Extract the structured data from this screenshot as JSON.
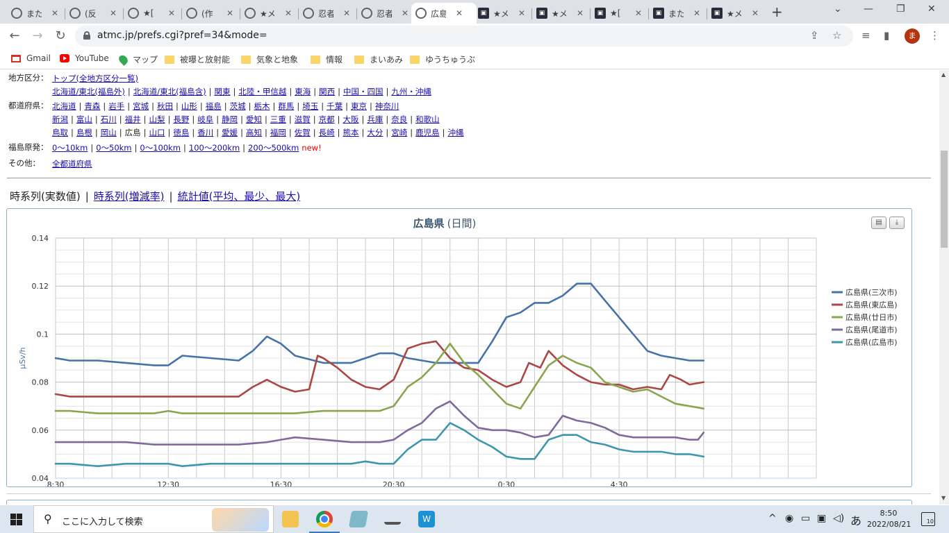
{
  "browser": {
    "tabs": [
      {
        "title": "また",
        "icon": "globe-icon",
        "active": false
      },
      {
        "title": "(反",
        "icon": "globe-icon",
        "active": false
      },
      {
        "title": "★[",
        "icon": "globe-icon",
        "active": false
      },
      {
        "title": "(作",
        "icon": "globe-icon",
        "active": false
      },
      {
        "title": "★メ",
        "icon": "globe-icon",
        "active": false
      },
      {
        "title": "忍者",
        "icon": "globe-icon",
        "active": false
      },
      {
        "title": "忍者",
        "icon": "globe-icon",
        "active": false
      },
      {
        "title": "広島",
        "icon": "globe-icon",
        "active": true
      },
      {
        "title": "★メ",
        "icon": "site-icon",
        "active": false
      },
      {
        "title": "★メ",
        "icon": "site-icon",
        "active": false
      },
      {
        "title": "★[",
        "icon": "site-icon",
        "active": false
      },
      {
        "title": "また",
        "icon": "site-icon",
        "active": false
      },
      {
        "title": "★メ",
        "icon": "site-icon",
        "active": false
      }
    ],
    "url": "atmc.jp/prefs.cgi?pref=34&mode=",
    "avatar_letter": "ま",
    "bookmarks": [
      {
        "label": "Gmail",
        "icon": "gmail-icon"
      },
      {
        "label": "YouTube",
        "icon": "youtube-icon"
      },
      {
        "label": "マップ",
        "icon": "maps-icon"
      },
      {
        "label": "被曝と放射能",
        "icon": "folder-icon"
      },
      {
        "label": "気象と地象",
        "icon": "folder-icon"
      },
      {
        "label": "情報",
        "icon": "folder-icon"
      },
      {
        "label": "まいあみ",
        "icon": "folder-icon"
      },
      {
        "label": "ゆうちゅうぶ",
        "icon": "folder-icon"
      }
    ]
  },
  "nav": {
    "region_label": "地方区分：",
    "region_lines": [
      [
        {
          "text": "トップ(全地方区分一覧)",
          "link": true
        }
      ],
      [
        {
          "text": "北海道/東北(福島外)",
          "link": true
        },
        {
          "text": "北海道/東北(福島含)",
          "link": true
        },
        {
          "text": "関東",
          "link": true
        },
        {
          "text": "北陸・甲信越",
          "link": true
        },
        {
          "text": "東海",
          "link": true
        },
        {
          "text": "関西",
          "link": true
        },
        {
          "text": "中国・四国",
          "link": true
        },
        {
          "text": "九州・沖縄",
          "link": true
        }
      ]
    ],
    "pref_label": "都道府県：",
    "pref_lines": [
      [
        {
          "text": "北海道",
          "link": true
        },
        {
          "text": "青森",
          "link": true
        },
        {
          "text": "岩手",
          "link": true
        },
        {
          "text": "宮城",
          "link": true
        },
        {
          "text": "秋田",
          "link": true
        },
        {
          "text": "山形",
          "link": true
        },
        {
          "text": "福島",
          "link": true
        },
        {
          "text": "茨城",
          "link": true
        },
        {
          "text": "栃木",
          "link": true
        },
        {
          "text": "群馬",
          "link": true
        },
        {
          "text": "埼玉",
          "link": true
        },
        {
          "text": "千葉",
          "link": true
        },
        {
          "text": "東京",
          "link": true
        },
        {
          "text": "神奈川",
          "link": true
        }
      ],
      [
        {
          "text": "新潟",
          "link": true
        },
        {
          "text": "富山",
          "link": true
        },
        {
          "text": "石川",
          "link": true
        },
        {
          "text": "福井",
          "link": true
        },
        {
          "text": "山梨",
          "link": true
        },
        {
          "text": "長野",
          "link": true
        },
        {
          "text": "岐阜",
          "link": true
        },
        {
          "text": "静岡",
          "link": true
        },
        {
          "text": "愛知",
          "link": true
        },
        {
          "text": "三重",
          "link": true
        },
        {
          "text": "滋賀",
          "link": true
        },
        {
          "text": "京都",
          "link": true
        },
        {
          "text": "大阪",
          "link": true
        },
        {
          "text": "兵庫",
          "link": true
        },
        {
          "text": "奈良",
          "link": true
        },
        {
          "text": "和歌山",
          "link": true
        }
      ],
      [
        {
          "text": "鳥取",
          "link": true
        },
        {
          "text": "島根",
          "link": true
        },
        {
          "text": "岡山",
          "link": true
        },
        {
          "text": "広島",
          "link": false
        },
        {
          "text": "山口",
          "link": true
        },
        {
          "text": "徳島",
          "link": true
        },
        {
          "text": "香川",
          "link": true
        },
        {
          "text": "愛媛",
          "link": true
        },
        {
          "text": "高知",
          "link": true
        },
        {
          "text": "福岡",
          "link": true
        },
        {
          "text": "佐賀",
          "link": true
        },
        {
          "text": "長崎",
          "link": true
        },
        {
          "text": "熊本",
          "link": true
        },
        {
          "text": "大分",
          "link": true
        },
        {
          "text": "宮崎",
          "link": true
        },
        {
          "text": "鹿児島",
          "link": true
        },
        {
          "text": "沖縄",
          "link": true
        }
      ]
    ],
    "fuku_label": "福島原発：",
    "fuku_lines": [
      [
        {
          "text": "0〜10km",
          "link": true
        },
        {
          "text": "0〜50km",
          "link": true
        },
        {
          "text": "0〜100km",
          "link": true
        },
        {
          "text": "100〜200km",
          "link": true
        },
        {
          "text": "200〜500km",
          "link": true
        }
      ]
    ],
    "fuku_new": "new!",
    "other_label": "その他：",
    "other_lines": [
      [
        {
          "text": "全都道府県",
          "link": true
        }
      ]
    ]
  },
  "view_tabs": [
    {
      "text": "時系列(実数値)",
      "link": false
    },
    {
      "text": "時系列(増減率)",
      "link": true
    },
    {
      "text": "統計値(平均、最少、最大)",
      "link": true
    }
  ],
  "chart_data": {
    "type": "line",
    "title": "広島県",
    "subtitle": "(日間)",
    "ylabel": "μSv/h",
    "xlabel": "",
    "ylim": [
      0.04,
      0.14
    ],
    "yticks": [
      "0.04",
      "0.06",
      "0.08",
      "0.1",
      "0.12",
      "0.14"
    ],
    "xlim": [
      8.5,
      35.5
    ],
    "xticks": [
      {
        "x": 8.5,
        "label": "8:30"
      },
      {
        "x": 12.5,
        "label": "12:30"
      },
      {
        "x": 16.5,
        "label": "16:30"
      },
      {
        "x": 20.5,
        "label": "20:30"
      },
      {
        "x": 24.5,
        "label": "0:30"
      },
      {
        "x": 28.5,
        "label": "4:30"
      }
    ],
    "grid": true,
    "legend_position": "right",
    "series": [
      {
        "name": "広島県(三次市)",
        "color": "#4572a7",
        "points": [
          [
            8.5,
            0.09
          ],
          [
            9,
            0.089
          ],
          [
            10,
            0.089
          ],
          [
            11,
            0.088
          ],
          [
            12,
            0.087
          ],
          [
            12.5,
            0.087
          ],
          [
            13,
            0.091
          ],
          [
            14,
            0.09
          ],
          [
            15,
            0.089
          ],
          [
            15.5,
            0.093
          ],
          [
            16,
            0.099
          ],
          [
            16.5,
            0.096
          ],
          [
            17,
            0.091
          ],
          [
            18,
            0.088
          ],
          [
            19,
            0.088
          ],
          [
            20,
            0.092
          ],
          [
            20.5,
            0.092
          ],
          [
            21,
            0.09
          ],
          [
            22,
            0.088
          ],
          [
            23,
            0.088
          ],
          [
            23.5,
            0.088
          ],
          [
            24,
            0.097
          ],
          [
            24.5,
            0.107
          ],
          [
            25,
            0.109
          ],
          [
            25.5,
            0.113
          ],
          [
            26,
            0.113
          ],
          [
            26.5,
            0.116
          ],
          [
            27,
            0.121
          ],
          [
            27.5,
            0.121
          ],
          [
            28,
            0.114
          ],
          [
            28.5,
            0.107
          ],
          [
            29,
            0.1
          ],
          [
            29.5,
            0.093
          ],
          [
            30,
            0.091
          ],
          [
            30.5,
            0.09
          ],
          [
            31,
            0.089
          ],
          [
            31.5,
            0.089
          ]
        ]
      },
      {
        "name": "広島県(東広島)",
        "color": "#aa4643",
        "points": [
          [
            8.5,
            0.075
          ],
          [
            9,
            0.074
          ],
          [
            10,
            0.074
          ],
          [
            11,
            0.074
          ],
          [
            12,
            0.074
          ],
          [
            12.5,
            0.074
          ],
          [
            13,
            0.074
          ],
          [
            14,
            0.074
          ],
          [
            15,
            0.074
          ],
          [
            15.5,
            0.078
          ],
          [
            16,
            0.081
          ],
          [
            16.5,
            0.078
          ],
          [
            17,
            0.076
          ],
          [
            17.5,
            0.077
          ],
          [
            17.8,
            0.091
          ],
          [
            18,
            0.09
          ],
          [
            18.5,
            0.086
          ],
          [
            19,
            0.081
          ],
          [
            19.5,
            0.078
          ],
          [
            20,
            0.077
          ],
          [
            20.5,
            0.081
          ],
          [
            21,
            0.094
          ],
          [
            21.5,
            0.096
          ],
          [
            22,
            0.097
          ],
          [
            22.5,
            0.09
          ],
          [
            23,
            0.086
          ],
          [
            23.5,
            0.085
          ],
          [
            24,
            0.081
          ],
          [
            24.5,
            0.078
          ],
          [
            25,
            0.08
          ],
          [
            25.3,
            0.088
          ],
          [
            25.7,
            0.086
          ],
          [
            26,
            0.093
          ],
          [
            26.5,
            0.087
          ],
          [
            27,
            0.083
          ],
          [
            27.5,
            0.08
          ],
          [
            28,
            0.079
          ],
          [
            28.5,
            0.079
          ],
          [
            29,
            0.077
          ],
          [
            29.5,
            0.078
          ],
          [
            30,
            0.077
          ],
          [
            30.3,
            0.083
          ],
          [
            30.7,
            0.081
          ],
          [
            31,
            0.079
          ],
          [
            31.5,
            0.08
          ]
        ]
      },
      {
        "name": "広島県(廿日市)",
        "color": "#89a54e",
        "points": [
          [
            8.5,
            0.068
          ],
          [
            9,
            0.068
          ],
          [
            10,
            0.067
          ],
          [
            11,
            0.067
          ],
          [
            12,
            0.067
          ],
          [
            12.5,
            0.068
          ],
          [
            13,
            0.067
          ],
          [
            14,
            0.067
          ],
          [
            15,
            0.067
          ],
          [
            16,
            0.067
          ],
          [
            17,
            0.067
          ],
          [
            18,
            0.068
          ],
          [
            19,
            0.068
          ],
          [
            20,
            0.068
          ],
          [
            20.5,
            0.07
          ],
          [
            21,
            0.078
          ],
          [
            21.5,
            0.082
          ],
          [
            22,
            0.088
          ],
          [
            22.5,
            0.096
          ],
          [
            23,
            0.088
          ],
          [
            23.5,
            0.083
          ],
          [
            24,
            0.077
          ],
          [
            24.5,
            0.071
          ],
          [
            25,
            0.069
          ],
          [
            25.5,
            0.078
          ],
          [
            26,
            0.087
          ],
          [
            26.5,
            0.091
          ],
          [
            27,
            0.088
          ],
          [
            27.5,
            0.086
          ],
          [
            28,
            0.08
          ],
          [
            28.5,
            0.078
          ],
          [
            29,
            0.076
          ],
          [
            29.5,
            0.077
          ],
          [
            30,
            0.074
          ],
          [
            30.5,
            0.071
          ],
          [
            31,
            0.07
          ],
          [
            31.5,
            0.069
          ]
        ]
      },
      {
        "name": "広島県(尾道市)",
        "color": "#80699b",
        "points": [
          [
            8.5,
            0.055
          ],
          [
            9,
            0.055
          ],
          [
            10,
            0.055
          ],
          [
            11,
            0.055
          ],
          [
            12,
            0.054
          ],
          [
            12.5,
            0.054
          ],
          [
            13,
            0.054
          ],
          [
            14,
            0.054
          ],
          [
            15,
            0.054
          ],
          [
            16,
            0.055
          ],
          [
            16.5,
            0.056
          ],
          [
            17,
            0.057
          ],
          [
            18,
            0.056
          ],
          [
            19,
            0.055
          ],
          [
            20,
            0.055
          ],
          [
            20.5,
            0.056
          ],
          [
            21,
            0.06
          ],
          [
            21.5,
            0.063
          ],
          [
            22,
            0.069
          ],
          [
            22.5,
            0.072
          ],
          [
            23,
            0.066
          ],
          [
            23.5,
            0.061
          ],
          [
            24,
            0.06
          ],
          [
            24.5,
            0.06
          ],
          [
            25,
            0.059
          ],
          [
            25.5,
            0.057
          ],
          [
            26,
            0.058
          ],
          [
            26.5,
            0.066
          ],
          [
            27,
            0.064
          ],
          [
            27.5,
            0.063
          ],
          [
            28,
            0.061
          ],
          [
            28.5,
            0.058
          ],
          [
            29,
            0.057
          ],
          [
            29.5,
            0.057
          ],
          [
            30,
            0.057
          ],
          [
            30.5,
            0.057
          ],
          [
            31,
            0.056
          ],
          [
            31.3,
            0.056
          ],
          [
            31.5,
            0.059
          ]
        ]
      },
      {
        "name": "広島県(広島市)",
        "color": "#3d96ae",
        "points": [
          [
            8.5,
            0.046
          ],
          [
            9,
            0.046
          ],
          [
            10,
            0.045
          ],
          [
            11,
            0.046
          ],
          [
            12,
            0.046
          ],
          [
            12.5,
            0.046
          ],
          [
            13,
            0.045
          ],
          [
            14,
            0.046
          ],
          [
            15,
            0.046
          ],
          [
            16,
            0.046
          ],
          [
            17,
            0.046
          ],
          [
            18,
            0.046
          ],
          [
            19,
            0.046
          ],
          [
            19.5,
            0.047
          ],
          [
            20,
            0.046
          ],
          [
            20.5,
            0.046
          ],
          [
            21,
            0.052
          ],
          [
            21.5,
            0.056
          ],
          [
            22,
            0.056
          ],
          [
            22.5,
            0.063
          ],
          [
            23,
            0.06
          ],
          [
            23.5,
            0.056
          ],
          [
            24,
            0.053
          ],
          [
            24.5,
            0.049
          ],
          [
            25,
            0.048
          ],
          [
            25.5,
            0.048
          ],
          [
            26,
            0.056
          ],
          [
            26.5,
            0.058
          ],
          [
            27,
            0.058
          ],
          [
            27.5,
            0.055
          ],
          [
            28,
            0.054
          ],
          [
            28.5,
            0.052
          ],
          [
            29,
            0.051
          ],
          [
            29.5,
            0.051
          ],
          [
            30,
            0.051
          ],
          [
            30.5,
            0.05
          ],
          [
            31,
            0.05
          ],
          [
            31.5,
            0.049
          ]
        ]
      }
    ]
  },
  "taskbar": {
    "search_placeholder": "ここに入力して検索",
    "time": "8:50",
    "date": "2022/08/21",
    "ime": "あ",
    "notification_count": "10"
  }
}
